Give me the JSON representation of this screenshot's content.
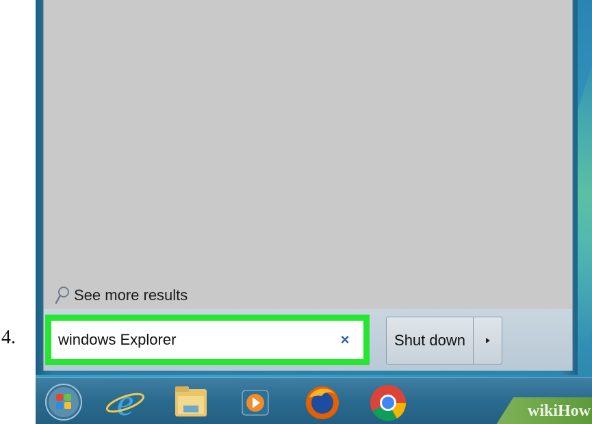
{
  "step": {
    "number": "4."
  },
  "start_menu": {
    "see_more_results": "See more results",
    "search": {
      "value": "windows Explorer",
      "clear_icon": "×"
    },
    "shutdown": {
      "label": "Shut down",
      "arrow_icon": "triangle-right"
    }
  },
  "taskbar": {
    "items": [
      {
        "name": "start-orb-icon"
      },
      {
        "name": "internet-explorer-icon"
      },
      {
        "name": "file-explorer-icon"
      },
      {
        "name": "media-player-icon"
      },
      {
        "name": "firefox-icon"
      },
      {
        "name": "chrome-icon"
      }
    ]
  },
  "watermark": {
    "text": "wikiHow"
  },
  "colors": {
    "highlight": "#27e632",
    "panel": "#c9c9c9",
    "taskbar": "#2a6a8f"
  }
}
